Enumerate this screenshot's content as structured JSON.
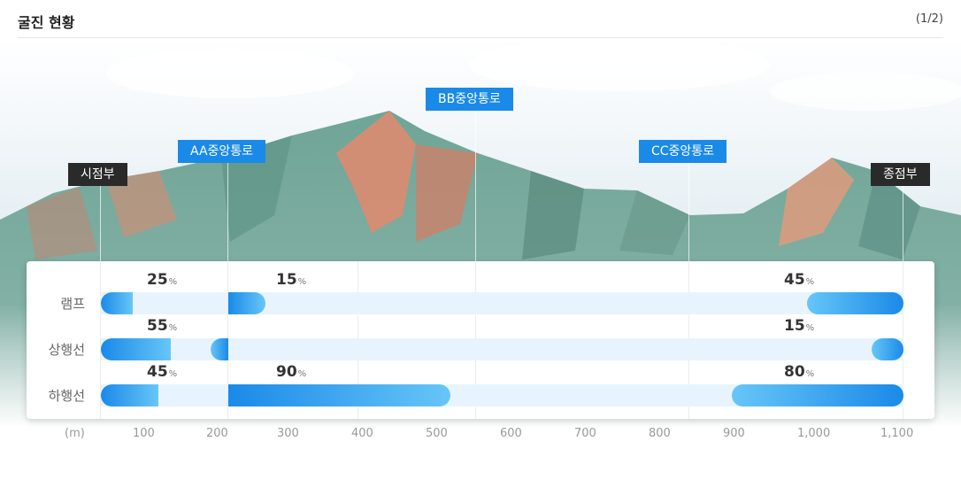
{
  "header": {
    "title": "굴진 현황",
    "pager": "(1/2)"
  },
  "markers": {
    "start": "시점부",
    "aa": "AA중앙통로",
    "bb": "BB중앙통로",
    "cc": "CC중앙통로",
    "end": "종점부"
  },
  "rows": [
    {
      "label": "램프",
      "start_pct": "25",
      "aa_pct": "15",
      "end_pct": "45",
      "start_fill": 0.25,
      "aa_fill": 0.15,
      "end_fill": 0.45
    },
    {
      "label": "상행선",
      "start_pct": "55",
      "aa_pct": "",
      "end_pct": "15",
      "start_fill": 0.55,
      "aa_fill": 0.1,
      "end_fill": 0.15
    },
    {
      "label": "하행선",
      "start_pct": "45",
      "aa_pct": "90",
      "end_pct": "80",
      "start_fill": 0.45,
      "aa_fill": 0.9,
      "end_fill": 0.8
    }
  ],
  "pct_unit": "%",
  "axis": {
    "unit": "(m)",
    "ticks": [
      "100",
      "200",
      "300",
      "400",
      "500",
      "600",
      "700",
      "800",
      "900",
      "1,000",
      "1,100"
    ]
  },
  "colors": {
    "accent": "#1a8ae8",
    "dark_label": "#2a2a2a",
    "track": "#e8f4fd"
  }
}
